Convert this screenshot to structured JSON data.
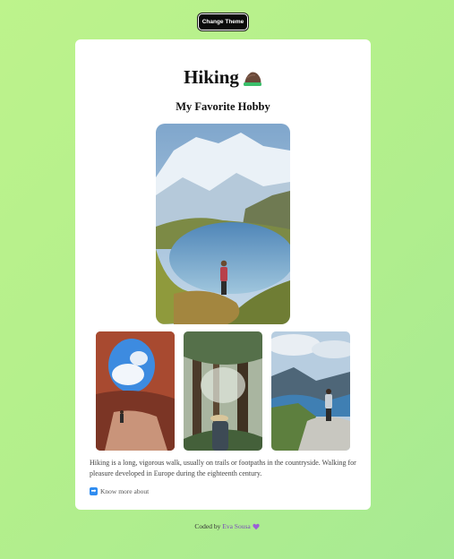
{
  "header": {
    "theme_button_label": "Change Theme"
  },
  "card": {
    "title": "Hiking",
    "title_icon": "rock-icon",
    "subtitle": "My Favorite Hobby",
    "description": "Hiking is a long, vigorous walk, usually on trails or footpaths in the countryside. Walking for pleasure developed in Europe during the eighteenth century.",
    "more_link": "Know more about",
    "more_icon": "right-arrow-icon"
  },
  "footer": {
    "prefix": "Coded by",
    "author": "Eva Sousa",
    "heart_icon": "purple-heart-icon"
  },
  "colors": {
    "background": "#b3ef8c",
    "card": "#ffffff",
    "button": "#0b0b0b",
    "author_link": "#7a4fb8"
  }
}
